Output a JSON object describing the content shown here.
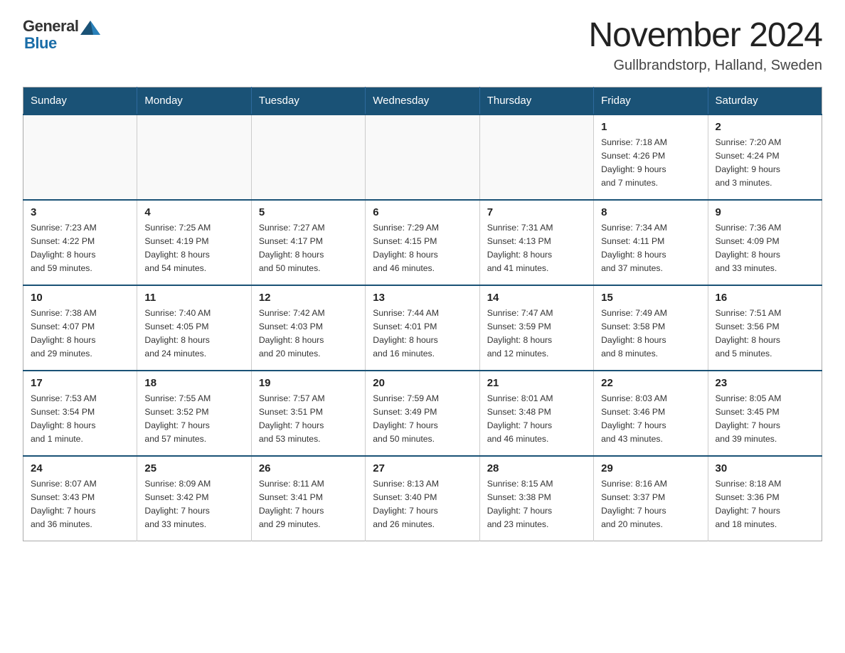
{
  "header": {
    "month_title": "November 2024",
    "location": "Gullbrandstorp, Halland, Sweden",
    "logo_general": "General",
    "logo_blue": "Blue"
  },
  "weekdays": [
    "Sunday",
    "Monday",
    "Tuesday",
    "Wednesday",
    "Thursday",
    "Friday",
    "Saturday"
  ],
  "weeks": [
    [
      {
        "day": "",
        "info": ""
      },
      {
        "day": "",
        "info": ""
      },
      {
        "day": "",
        "info": ""
      },
      {
        "day": "",
        "info": ""
      },
      {
        "day": "",
        "info": ""
      },
      {
        "day": "1",
        "info": "Sunrise: 7:18 AM\nSunset: 4:26 PM\nDaylight: 9 hours\nand 7 minutes."
      },
      {
        "day": "2",
        "info": "Sunrise: 7:20 AM\nSunset: 4:24 PM\nDaylight: 9 hours\nand 3 minutes."
      }
    ],
    [
      {
        "day": "3",
        "info": "Sunrise: 7:23 AM\nSunset: 4:22 PM\nDaylight: 8 hours\nand 59 minutes."
      },
      {
        "day": "4",
        "info": "Sunrise: 7:25 AM\nSunset: 4:19 PM\nDaylight: 8 hours\nand 54 minutes."
      },
      {
        "day": "5",
        "info": "Sunrise: 7:27 AM\nSunset: 4:17 PM\nDaylight: 8 hours\nand 50 minutes."
      },
      {
        "day": "6",
        "info": "Sunrise: 7:29 AM\nSunset: 4:15 PM\nDaylight: 8 hours\nand 46 minutes."
      },
      {
        "day": "7",
        "info": "Sunrise: 7:31 AM\nSunset: 4:13 PM\nDaylight: 8 hours\nand 41 minutes."
      },
      {
        "day": "8",
        "info": "Sunrise: 7:34 AM\nSunset: 4:11 PM\nDaylight: 8 hours\nand 37 minutes."
      },
      {
        "day": "9",
        "info": "Sunrise: 7:36 AM\nSunset: 4:09 PM\nDaylight: 8 hours\nand 33 minutes."
      }
    ],
    [
      {
        "day": "10",
        "info": "Sunrise: 7:38 AM\nSunset: 4:07 PM\nDaylight: 8 hours\nand 29 minutes."
      },
      {
        "day": "11",
        "info": "Sunrise: 7:40 AM\nSunset: 4:05 PM\nDaylight: 8 hours\nand 24 minutes."
      },
      {
        "day": "12",
        "info": "Sunrise: 7:42 AM\nSunset: 4:03 PM\nDaylight: 8 hours\nand 20 minutes."
      },
      {
        "day": "13",
        "info": "Sunrise: 7:44 AM\nSunset: 4:01 PM\nDaylight: 8 hours\nand 16 minutes."
      },
      {
        "day": "14",
        "info": "Sunrise: 7:47 AM\nSunset: 3:59 PM\nDaylight: 8 hours\nand 12 minutes."
      },
      {
        "day": "15",
        "info": "Sunrise: 7:49 AM\nSunset: 3:58 PM\nDaylight: 8 hours\nand 8 minutes."
      },
      {
        "day": "16",
        "info": "Sunrise: 7:51 AM\nSunset: 3:56 PM\nDaylight: 8 hours\nand 5 minutes."
      }
    ],
    [
      {
        "day": "17",
        "info": "Sunrise: 7:53 AM\nSunset: 3:54 PM\nDaylight: 8 hours\nand 1 minute."
      },
      {
        "day": "18",
        "info": "Sunrise: 7:55 AM\nSunset: 3:52 PM\nDaylight: 7 hours\nand 57 minutes."
      },
      {
        "day": "19",
        "info": "Sunrise: 7:57 AM\nSunset: 3:51 PM\nDaylight: 7 hours\nand 53 minutes."
      },
      {
        "day": "20",
        "info": "Sunrise: 7:59 AM\nSunset: 3:49 PM\nDaylight: 7 hours\nand 50 minutes."
      },
      {
        "day": "21",
        "info": "Sunrise: 8:01 AM\nSunset: 3:48 PM\nDaylight: 7 hours\nand 46 minutes."
      },
      {
        "day": "22",
        "info": "Sunrise: 8:03 AM\nSunset: 3:46 PM\nDaylight: 7 hours\nand 43 minutes."
      },
      {
        "day": "23",
        "info": "Sunrise: 8:05 AM\nSunset: 3:45 PM\nDaylight: 7 hours\nand 39 minutes."
      }
    ],
    [
      {
        "day": "24",
        "info": "Sunrise: 8:07 AM\nSunset: 3:43 PM\nDaylight: 7 hours\nand 36 minutes."
      },
      {
        "day": "25",
        "info": "Sunrise: 8:09 AM\nSunset: 3:42 PM\nDaylight: 7 hours\nand 33 minutes."
      },
      {
        "day": "26",
        "info": "Sunrise: 8:11 AM\nSunset: 3:41 PM\nDaylight: 7 hours\nand 29 minutes."
      },
      {
        "day": "27",
        "info": "Sunrise: 8:13 AM\nSunset: 3:40 PM\nDaylight: 7 hours\nand 26 minutes."
      },
      {
        "day": "28",
        "info": "Sunrise: 8:15 AM\nSunset: 3:38 PM\nDaylight: 7 hours\nand 23 minutes."
      },
      {
        "day": "29",
        "info": "Sunrise: 8:16 AM\nSunset: 3:37 PM\nDaylight: 7 hours\nand 20 minutes."
      },
      {
        "day": "30",
        "info": "Sunrise: 8:18 AM\nSunset: 3:36 PM\nDaylight: 7 hours\nand 18 minutes."
      }
    ]
  ]
}
